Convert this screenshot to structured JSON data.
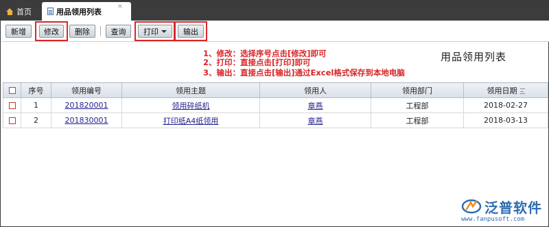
{
  "tabs": [
    {
      "label": "首页",
      "icon": "home-icon",
      "active": false
    },
    {
      "label": "用品领用列表",
      "icon": "document-icon",
      "active": true,
      "close": "×"
    }
  ],
  "toolbar": {
    "new_label": "新增",
    "edit_label": "修改",
    "delete_label": "删除",
    "query_label": "查询",
    "print_label": "打印",
    "export_label": "输出"
  },
  "annotations": {
    "line1": "1、修改：选择序号点击[修改]即可",
    "line2": "2、打印：直接点击[打印]即可",
    "line3": "3、输出：直接点击[输出]通过Excel格式保存到本地电脑"
  },
  "list_title": "用品领用列表",
  "table": {
    "columns": [
      "序号",
      "领用编号",
      "领用主题",
      "领用人",
      "领用部门",
      "领用日期"
    ],
    "rows": [
      {
        "seq": "1",
        "code": "201820001",
        "subject": "领用碎纸机",
        "person": "章燕",
        "dept": "工程部",
        "date": "2018-02-27"
      },
      {
        "seq": "2",
        "code": "201830001",
        "subject": "打印纸A4纸领用",
        "person": "章燕",
        "dept": "工程部",
        "date": "2018-03-13"
      }
    ]
  },
  "logo": {
    "name": "泛普软件",
    "url": "www.fanpusoft.com"
  },
  "colors": {
    "annotation_red": "#d8262a",
    "link_blue": "#1e1e8c",
    "tabbar_dark": "#3c3c3c",
    "logo_blue": "#2e6cb3"
  }
}
